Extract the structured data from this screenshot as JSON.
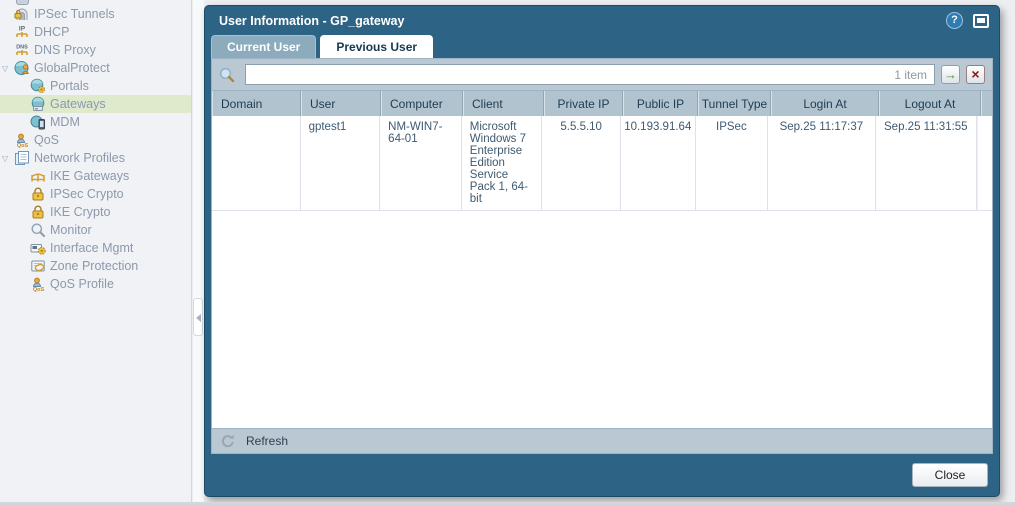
{
  "sidebar": {
    "items": [
      {
        "label": "IPSec Tunnels",
        "icon": "ipsec-tunnels-icon",
        "level": 0,
        "expandable": false,
        "selected": false
      },
      {
        "label": "DHCP",
        "icon": "dhcp-icon",
        "level": 0,
        "expandable": false,
        "selected": false
      },
      {
        "label": "DNS Proxy",
        "icon": "dns-proxy-icon",
        "level": 0,
        "expandable": false,
        "selected": false
      },
      {
        "label": "GlobalProtect",
        "icon": "globalprotect-icon",
        "level": 0,
        "expandable": true,
        "expanded": true,
        "selected": false
      },
      {
        "label": "Portals",
        "icon": "portals-icon",
        "level": 1,
        "expandable": false,
        "selected": false
      },
      {
        "label": "Gateways",
        "icon": "gateways-icon",
        "level": 1,
        "expandable": false,
        "selected": true
      },
      {
        "label": "MDM",
        "icon": "mdm-icon",
        "level": 1,
        "expandable": false,
        "selected": false
      },
      {
        "label": "QoS",
        "icon": "qos-icon",
        "level": 0,
        "expandable": false,
        "selected": false
      },
      {
        "label": "Network Profiles",
        "icon": "network-profiles-icon",
        "level": 0,
        "expandable": true,
        "expanded": true,
        "selected": false
      },
      {
        "label": "IKE Gateways",
        "icon": "ike-gateways-icon",
        "level": 1,
        "expandable": false,
        "selected": false
      },
      {
        "label": "IPSec Crypto",
        "icon": "ipsec-crypto-icon",
        "level": 1,
        "expandable": false,
        "selected": false
      },
      {
        "label": "IKE Crypto",
        "icon": "ike-crypto-icon",
        "level": 1,
        "expandable": false,
        "selected": false
      },
      {
        "label": "Monitor",
        "icon": "monitor-icon",
        "level": 1,
        "expandable": false,
        "selected": false
      },
      {
        "label": "Interface Mgmt",
        "icon": "interface-mgmt-icon",
        "level": 1,
        "expandable": false,
        "selected": false
      },
      {
        "label": "Zone Protection",
        "icon": "zone-protection-icon",
        "level": 1,
        "expandable": false,
        "selected": false
      },
      {
        "label": "QoS Profile",
        "icon": "qos-profile-icon",
        "level": 1,
        "expandable": false,
        "selected": false
      }
    ]
  },
  "glyphs": {
    "help": "?",
    "apply_arrow": "→",
    "clear_x": "×",
    "caret_expanded": "▽"
  },
  "dialog": {
    "title": "User Information - GP_gateway",
    "tabs": [
      {
        "label": "Current User",
        "active": false
      },
      {
        "label": "Previous User",
        "active": true
      }
    ],
    "toolbar": {
      "search_value": "",
      "item_count": "1 item"
    },
    "table": {
      "columns": [
        "Domain",
        "User",
        "Computer",
        "Client",
        "Private IP",
        "Public IP",
        "Tunnel Type",
        "Login At",
        "Logout At"
      ],
      "rows": [
        {
          "domain": "",
          "user": "gptest1",
          "computer": "NM-WIN7-64-01",
          "client": "Microsoft Windows 7 Enterprise Edition Service Pack 1, 64-bit",
          "private_ip": "5.5.5.10",
          "public_ip": "10.193.91.64",
          "tunnel_type": "IPSec",
          "login_at": "Sep.25 11:17:37",
          "logout_at": "Sep.25 11:31:55"
        }
      ]
    },
    "refresh_label": "Refresh",
    "close_label": "Close"
  },
  "colors": {
    "dialog_frame": "#2d6384",
    "selected_item_bg": "#dfe9cc",
    "toolbar_bg": "#b9c8d2",
    "table_header_bg": "#b1c3ce",
    "accent_green": "#5d8f23",
    "accent_red": "#8b1a10"
  }
}
